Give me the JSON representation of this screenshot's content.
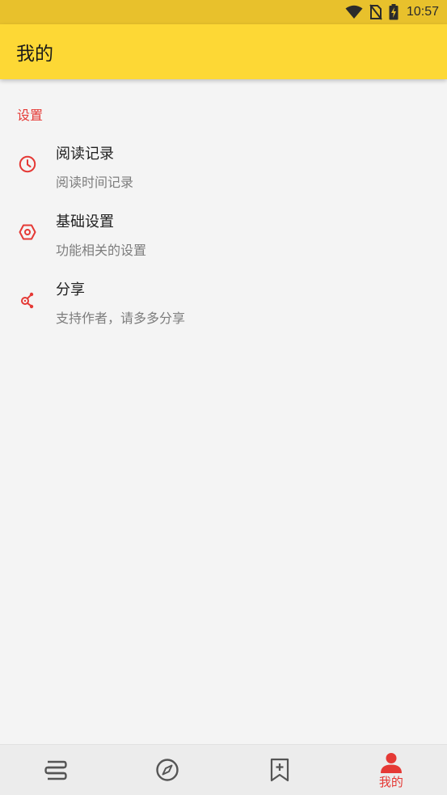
{
  "status_bar": {
    "time": "10:57",
    "icons": [
      "wifi-icon",
      "no-sim-icon",
      "battery-charging-icon"
    ]
  },
  "app_bar": {
    "title": "我的",
    "background_color": "#fdd835"
  },
  "settings": {
    "section_title": "设置",
    "accent_color": "#e53935",
    "items": [
      {
        "icon": "clock-icon",
        "title": "阅读记录",
        "summary": "阅读时间记录"
      },
      {
        "icon": "hexagon-settings-icon",
        "title": "基础设置",
        "summary": "功能相关的设置"
      },
      {
        "icon": "share-icon",
        "title": "分享",
        "summary": "支持作者，请多多分享"
      }
    ]
  },
  "bottom_nav": {
    "items": [
      {
        "icon": "bookshelf-icon",
        "label": "",
        "active": false
      },
      {
        "icon": "compass-icon",
        "label": "",
        "active": false
      },
      {
        "icon": "bookmark-add-icon",
        "label": "",
        "active": false
      },
      {
        "icon": "person-icon",
        "label": "我的",
        "active": true
      }
    ],
    "active_color": "#e53935",
    "inactive_color": "#555555"
  }
}
